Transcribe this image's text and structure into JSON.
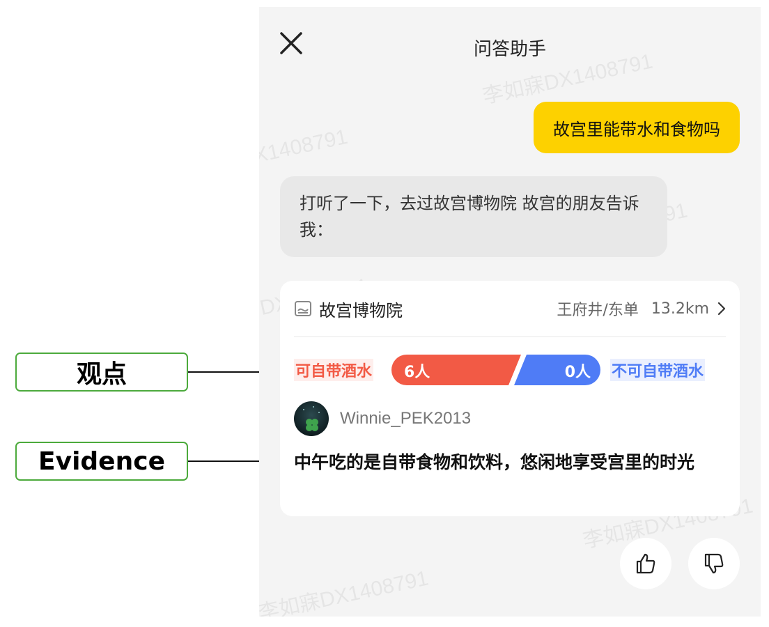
{
  "annotations": {
    "viewpoint_label": "观点",
    "evidence_label": "Evidence"
  },
  "header": {
    "title": "问答助手",
    "close_icon": "close-icon"
  },
  "chat": {
    "user_message": "故宫里能带水和食物吗",
    "bot_message": "打听了一下，去过故宫博物院 故宫的朋友告诉我："
  },
  "card": {
    "poi_name": "故宫博物院",
    "poi_area": "王府井/东单",
    "poi_distance": "13.2km",
    "vote": {
      "pro_label": "可自带酒水",
      "pro_count": "6人",
      "con_label": "不可自带酒水",
      "con_count": "0人",
      "pro_color": "#f25a45",
      "con_color": "#4f7cf6"
    },
    "author": "Winnie_PEK2013",
    "evidence": "中午吃的是自带食物和饮料，悠闲地享受宫里的时光"
  },
  "watermark": "李如寐DX1408791",
  "watermark_fragment": "DX1408791",
  "feedback": {
    "like_icon": "thumbs-up-icon",
    "dislike_icon": "thumbs-down-icon"
  },
  "colors": {
    "accent_yellow": "#fdd100",
    "annotation_green": "#4caa3c"
  }
}
